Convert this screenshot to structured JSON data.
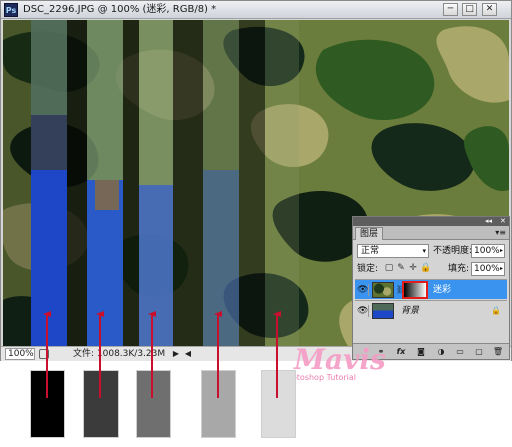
{
  "window": {
    "app_icon": "Ps",
    "title": "DSC_2296.JPG @ 100% (迷彩, RGB/8) *",
    "minimize_glyph": "─",
    "maximize_glyph": "□",
    "close_glyph": "✕"
  },
  "statusbar": {
    "zoom": "100%",
    "file_info": "文件: 1008.3K/3.23M",
    "arrow_glyph": "▶",
    "scroll_left_glyph": "◀"
  },
  "layers_panel": {
    "tab_label": "图层",
    "collapse_glyph": "◂◂",
    "close_glyph": "✕",
    "menu_glyph": "▾≡",
    "blend_mode": "正常",
    "select_caret": "▾",
    "opacity_label": "不透明度:",
    "opacity_value": "100%",
    "lock_label": "锁定:",
    "lock_icons": [
      "transparency-lock-icon",
      "brush-lock-icon",
      "move-lock-icon",
      "padlock-icon"
    ],
    "lock_glyphs": [
      "▢",
      "✎",
      "✛",
      "🔒"
    ],
    "fill_label": "填充:",
    "fill_value": "100%",
    "layers": [
      {
        "name": "迷彩",
        "selected": true,
        "has_mask": true,
        "eye": "👁",
        "chain": "⛓"
      },
      {
        "name": "背景",
        "selected": false,
        "has_mask": false,
        "eye": "👁",
        "lock": "🔒"
      }
    ],
    "bottom_glyphs": [
      "⚭",
      "fx",
      "◙",
      "◑",
      "▭",
      "▢",
      "🗑"
    ]
  },
  "watermark": {
    "text": "Mavis",
    "subtext": "Photoshop Tutorial"
  },
  "swatches": [
    {
      "color": "#000000"
    },
    {
      "color": "#3b3b3b"
    },
    {
      "color": "#6f6f6f"
    },
    {
      "color": "#a8a8a8"
    },
    {
      "color": "#dcdcdc"
    }
  ],
  "arrow_color": "#c8102e"
}
